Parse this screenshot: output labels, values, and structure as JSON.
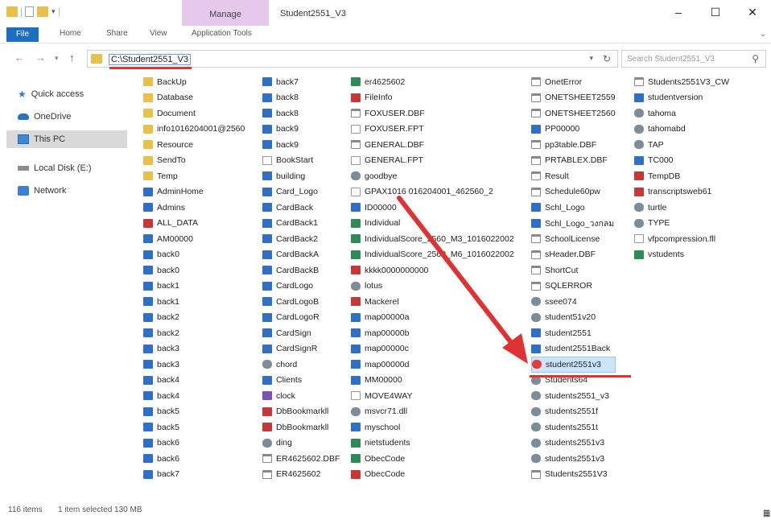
{
  "titlebar": {
    "manage_tab": "Manage",
    "window_title": "Student2551_V3",
    "minimize": "–",
    "maximize": "☐",
    "close": "✕"
  },
  "ribbon": {
    "tabs": [
      "File",
      "Home",
      "Share",
      "View",
      "Application Tools"
    ]
  },
  "address": {
    "path": "C:\\Student2551_V3",
    "search_placeholder": "Search Student2551_V3"
  },
  "navpane": {
    "items": [
      "Quick access",
      "OneDrive",
      "This PC",
      "Local Disk (E:)",
      "Network"
    ]
  },
  "files": {
    "col1": [
      {
        "name": "BackUp",
        "icon": "folder"
      },
      {
        "name": "Database",
        "icon": "folder"
      },
      {
        "name": "Document",
        "icon": "folder"
      },
      {
        "name": "info1016204001@2560",
        "icon": "folder"
      },
      {
        "name": "Resource",
        "icon": "folder"
      },
      {
        "name": "SendTo",
        "icon": "folder"
      },
      {
        "name": "Temp",
        "icon": "folder"
      },
      {
        "name": "AdminHome",
        "icon": "app"
      },
      {
        "name": "Admins",
        "icon": "app"
      },
      {
        "name": "ALL_DATA",
        "icon": "access"
      },
      {
        "name": "AM00000",
        "icon": "app"
      },
      {
        "name": "back0",
        "icon": "app"
      },
      {
        "name": "back0",
        "icon": "app"
      },
      {
        "name": "back1",
        "icon": "app"
      },
      {
        "name": "back1",
        "icon": "app"
      },
      {
        "name": "back2",
        "icon": "app"
      },
      {
        "name": "back2",
        "icon": "app"
      },
      {
        "name": "back3",
        "icon": "app"
      },
      {
        "name": "back3",
        "icon": "app"
      },
      {
        "name": "back4",
        "icon": "app"
      },
      {
        "name": "back4",
        "icon": "app"
      },
      {
        "name": "back5",
        "icon": "app"
      },
      {
        "name": "back5",
        "icon": "app"
      },
      {
        "name": "back6",
        "icon": "app"
      },
      {
        "name": "back6",
        "icon": "app"
      },
      {
        "name": "back7",
        "icon": "app"
      }
    ],
    "col2": [
      {
        "name": "back7",
        "icon": "app"
      },
      {
        "name": "back8",
        "icon": "app"
      },
      {
        "name": "back8",
        "icon": "app"
      },
      {
        "name": "back9",
        "icon": "app"
      },
      {
        "name": "back9",
        "icon": "app"
      },
      {
        "name": "BookStart",
        "icon": "file"
      },
      {
        "name": "building",
        "icon": "app"
      },
      {
        "name": "Card_Logo",
        "icon": "app"
      },
      {
        "name": "CardBack",
        "icon": "app"
      },
      {
        "name": "CardBack1",
        "icon": "app"
      },
      {
        "name": "CardBack2",
        "icon": "app"
      },
      {
        "name": "CardBackA",
        "icon": "app"
      },
      {
        "name": "CardBackB",
        "icon": "app"
      },
      {
        "name": "CardLogo",
        "icon": "app"
      },
      {
        "name": "CardLogoB",
        "icon": "app"
      },
      {
        "name": "CardLogoR",
        "icon": "app"
      },
      {
        "name": "CardSign",
        "icon": "app"
      },
      {
        "name": "CardSignR",
        "icon": "app"
      },
      {
        "name": "chord",
        "icon": "gear"
      },
      {
        "name": "Clients",
        "icon": "app"
      },
      {
        "name": "clock",
        "icon": "purple"
      },
      {
        "name": "DbBookmarkll",
        "icon": "access"
      },
      {
        "name": "DbBookmarkll",
        "icon": "access"
      },
      {
        "name": "ding",
        "icon": "gear"
      },
      {
        "name": "ER4625602.DBF",
        "icon": "db"
      },
      {
        "name": "ER4625602",
        "icon": "db"
      }
    ],
    "col3": [
      {
        "name": "er4625602",
        "icon": "excel"
      },
      {
        "name": "FileInfo",
        "icon": "access"
      },
      {
        "name": "FOXUSER.DBF",
        "icon": "db"
      },
      {
        "name": "FOXUSER.FPT",
        "icon": "file"
      },
      {
        "name": "GENERAL.DBF",
        "icon": "db"
      },
      {
        "name": "GENERAL.FPT",
        "icon": "file"
      },
      {
        "name": "goodbye",
        "icon": "gear"
      },
      {
        "name": "GPAX1016 016204001_462560_2",
        "icon": "file"
      },
      {
        "name": "ID00000",
        "icon": "app"
      },
      {
        "name": "Individual",
        "icon": "excel"
      },
      {
        "name": "IndividualScore_2560_M3_1016022002",
        "icon": "excel"
      },
      {
        "name": "IndividualScore_2560_M6_1016022002",
        "icon": "excel"
      },
      {
        "name": "kkkk0000000000",
        "icon": "access"
      },
      {
        "name": "lotus",
        "icon": "gear"
      },
      {
        "name": "Mackerel",
        "icon": "access"
      },
      {
        "name": "map00000a",
        "icon": "app"
      },
      {
        "name": "map00000b",
        "icon": "app"
      },
      {
        "name": "map00000c",
        "icon": "app"
      },
      {
        "name": "map00000d",
        "icon": "app"
      },
      {
        "name": "MM00000",
        "icon": "app"
      },
      {
        "name": "MOVE4WAY",
        "icon": "file"
      },
      {
        "name": "msvcr71.dll",
        "icon": "gear"
      },
      {
        "name": "myschool",
        "icon": "app"
      },
      {
        "name": "nietstudents",
        "icon": "excel"
      },
      {
        "name": "ObecCode",
        "icon": "excel"
      },
      {
        "name": "ObecCode",
        "icon": "access"
      }
    ],
    "col4": [
      {
        "name": "OnetError",
        "icon": "db"
      },
      {
        "name": "ONETSHEET2559",
        "icon": "db"
      },
      {
        "name": "ONETSHEET2560",
        "icon": "db"
      },
      {
        "name": "PP00000",
        "icon": "app"
      },
      {
        "name": "pp3table.DBF",
        "icon": "db"
      },
      {
        "name": "PRTABLEX.DBF",
        "icon": "db"
      },
      {
        "name": "Result",
        "icon": "db"
      },
      {
        "name": "Schedule60pw",
        "icon": "db"
      },
      {
        "name": "Schl_Logo",
        "icon": "app"
      },
      {
        "name": "Schl_Logo_วงกลม",
        "icon": "app"
      },
      {
        "name": "SchoolLicense",
        "icon": "db"
      },
      {
        "name": "sHeader.DBF",
        "icon": "db"
      },
      {
        "name": "ShortCut",
        "icon": "db"
      },
      {
        "name": "SQLERROR",
        "icon": "db"
      },
      {
        "name": "ssee074",
        "icon": "gear"
      },
      {
        "name": "student51v20",
        "icon": "gear"
      },
      {
        "name": "student2551",
        "icon": "app"
      },
      {
        "name": "student2551Back",
        "icon": "app"
      },
      {
        "name": "student2551v3",
        "icon": "special"
      },
      {
        "name": "Students64",
        "icon": "gear"
      },
      {
        "name": "students2551_v3",
        "icon": "gear"
      },
      {
        "name": "students2551f",
        "icon": "gear"
      },
      {
        "name": "students2551t",
        "icon": "gear"
      },
      {
        "name": "students2551v3",
        "icon": "gear"
      },
      {
        "name": "students2551v3",
        "icon": "gear"
      },
      {
        "name": "Students2551V3",
        "icon": "db"
      }
    ],
    "col5": [
      {
        "name": "Students2551V3_CW",
        "icon": "db"
      },
      {
        "name": "studentversion",
        "icon": "app"
      },
      {
        "name": "tahoma",
        "icon": "gear"
      },
      {
        "name": "tahomabd",
        "icon": "gear"
      },
      {
        "name": "TAP",
        "icon": "gear"
      },
      {
        "name": "TC000",
        "icon": "app"
      },
      {
        "name": "TempDB",
        "icon": "access"
      },
      {
        "name": "transcriptsweb61",
        "icon": "access"
      },
      {
        "name": "turtle",
        "icon": "gear"
      },
      {
        "name": "TYPE",
        "icon": "gear"
      },
      {
        "name": "vfpcompression.fll",
        "icon": "file"
      },
      {
        "name": "vstudents",
        "icon": "excel"
      }
    ],
    "selected_name": "student2551v3"
  },
  "status": {
    "items_count": "116 items",
    "selected_info": "1 item selected  130 MB"
  },
  "colors": {
    "selection_bg": "#cce5fb",
    "annotation": "#e03232",
    "manage_tab": "#e6c8ec",
    "file_tab": "#1c6fc0"
  }
}
